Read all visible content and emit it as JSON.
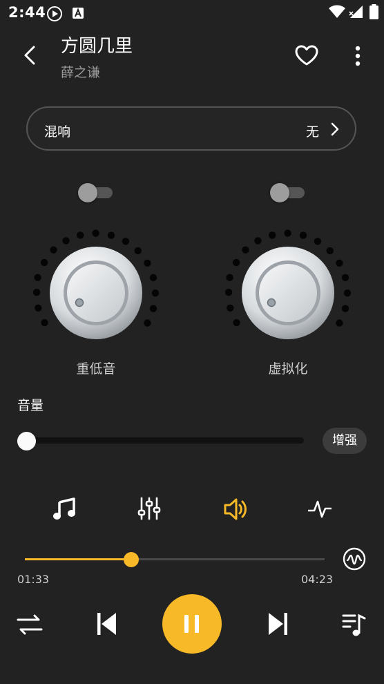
{
  "status_bar": {
    "time": "2:44"
  },
  "header": {
    "title": "方圆几里",
    "artist": "薛之谦"
  },
  "reverb": {
    "label": "混响",
    "value": "无"
  },
  "effects": {
    "bass": {
      "label": "重低音",
      "enabled": false
    },
    "virtualizer": {
      "label": "虚拟化",
      "enabled": false
    }
  },
  "volume": {
    "label": "音量",
    "level": 0,
    "boost_label": "增强"
  },
  "tabs": [
    "music-note-icon",
    "equalizer-icon",
    "speaker-icon",
    "pulse-icon"
  ],
  "playback": {
    "elapsed": "01:33",
    "total": "04:23",
    "progress": 0.354
  },
  "colors": {
    "accent": "#f8b928",
    "background": "#222222"
  }
}
